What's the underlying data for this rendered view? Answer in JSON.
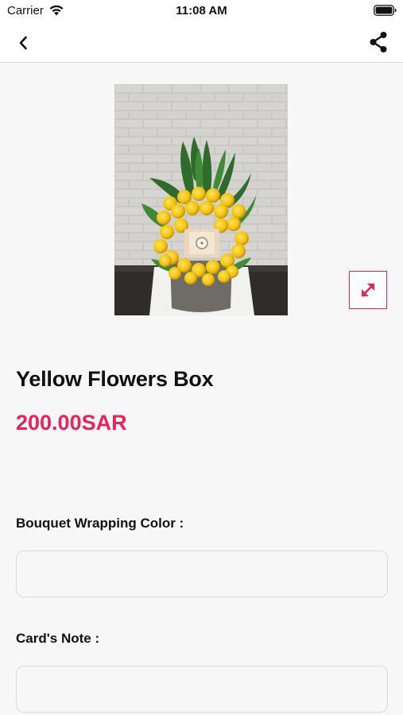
{
  "status_bar": {
    "carrier": "Carrier",
    "time": "11:08 AM"
  },
  "nav": {
    "back_icon": "chevron-left-icon",
    "share_icon": "share-icon"
  },
  "product": {
    "image_description": "bouquet-photo",
    "name": "Yellow Flowers Box",
    "price": "200.00SAR",
    "expand_icon": "expand-icon"
  },
  "form": {
    "wrapping_color_label": "Bouquet Wrapping Color :",
    "wrapping_color_value": "",
    "card_note_label": "Card's Note :",
    "card_note_value": ""
  },
  "colors": {
    "accent": "#e5245a",
    "background": "#f7f7f7",
    "bar": "#ffffff"
  }
}
